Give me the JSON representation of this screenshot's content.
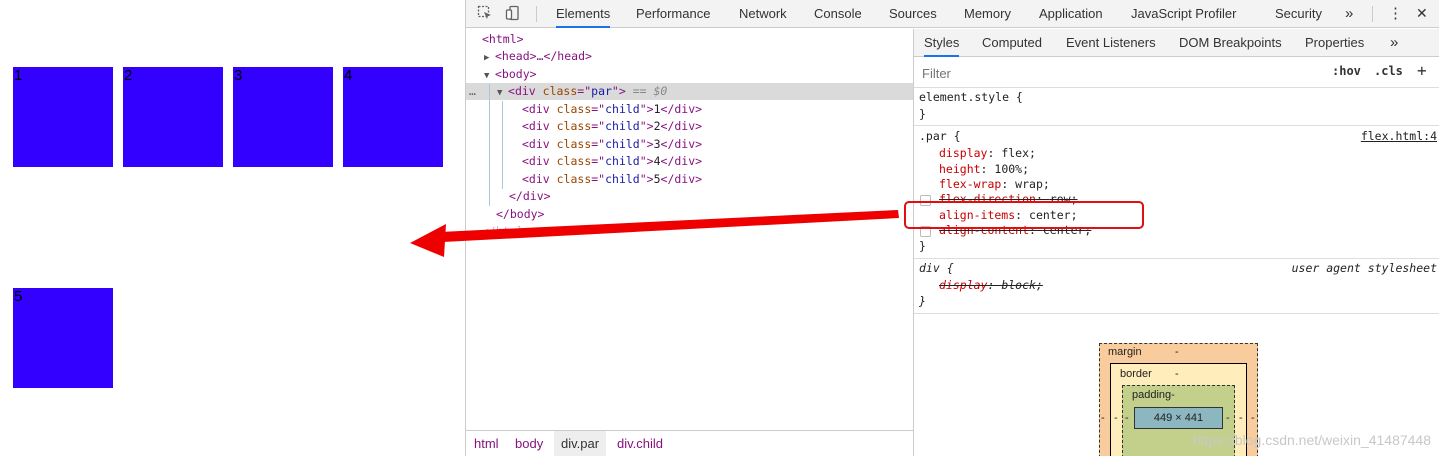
{
  "viewport": {
    "children": [
      "1",
      "2",
      "3",
      "4",
      "5"
    ]
  },
  "devtools": {
    "tabs": [
      "Elements",
      "Performance",
      "Network",
      "Console",
      "Sources",
      "Memory",
      "Application",
      "JavaScript Profiler",
      "Security"
    ],
    "active_tab": "Elements",
    "more_tabs": "»",
    "kebab": "⋮",
    "close": "✕"
  },
  "dom": {
    "html_open": "<html>",
    "head": "<head>…</head>",
    "body_open": "<body>",
    "ellipsis": "…",
    "par_tag": "div",
    "par_attr": "class",
    "par_val": "par",
    "dollar": "== $0",
    "children": [
      {
        "attr": "class",
        "val": "child",
        "text": "1"
      },
      {
        "attr": "class",
        "val": "child",
        "text": "2"
      },
      {
        "attr": "class",
        "val": "child",
        "text": "3"
      },
      {
        "attr": "class",
        "val": "child",
        "text": "4"
      },
      {
        "attr": "class",
        "val": "child",
        "text": "5"
      }
    ],
    "div_close": "</div>",
    "body_close": "</body>",
    "html_close": "</html>"
  },
  "breadcrumbs": [
    "html",
    "body",
    "div.par",
    "div.child"
  ],
  "styles": {
    "subtabs": [
      "Styles",
      "Computed",
      "Event Listeners",
      "DOM Breakpoints",
      "Properties"
    ],
    "active_subtab": "Styles",
    "filter_placeholder": "Filter",
    "hov": ":hov",
    "cls": ".cls",
    "plus": "+",
    "element_style": "element.style {",
    "close_brace": "}",
    "par_selector": ".par {",
    "par_source": "flex.html:4",
    "par_props": [
      {
        "name": "display",
        "value": "flex;"
      },
      {
        "name": "height",
        "value": "100%;"
      },
      {
        "name": "flex-wrap",
        "value": "wrap;"
      },
      {
        "name": "flex-direction",
        "value": "row;"
      },
      {
        "name": "align-items",
        "value": "center;"
      },
      {
        "name": "align-content",
        "value": "center;"
      }
    ],
    "div_selector": "div {",
    "div_source": "user agent stylesheet",
    "div_props": [
      {
        "name": "display",
        "value": "block;"
      }
    ]
  },
  "box_model": {
    "margin_label": "margin",
    "margin_val": "-",
    "border_label": "border",
    "border_val": "-",
    "padding_label": "padding-",
    "content": "449 × 441",
    "side_dash": "-"
  },
  "watermark": "https://blog.csdn.net/weixin_41487448",
  "colors": {
    "child_box": "#3300ff",
    "annotation_red": "#e01010",
    "active_tab_underline": "#1a73e8"
  }
}
